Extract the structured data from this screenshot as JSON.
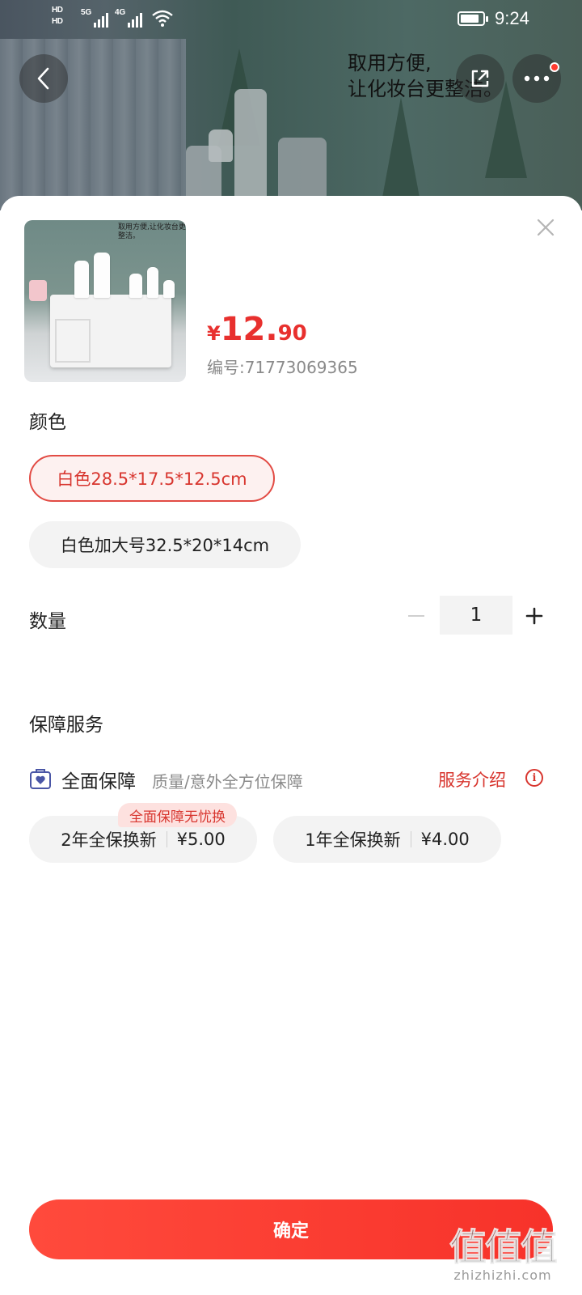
{
  "status_bar": {
    "hd1": "HD",
    "hd2": "HD",
    "net1": "5G",
    "net2": "4G",
    "time": "9:24"
  },
  "background": {
    "caption_line1": "取用方便,",
    "caption_line2": "让化妆台更整洁。"
  },
  "product": {
    "thumb_caption": "取用方便,让化妆台更整洁。",
    "price_currency": "¥",
    "price_integer": "12.",
    "price_decimal": "90",
    "sku_label": "编号:71773069365"
  },
  "color_section": {
    "title": "颜色",
    "options": [
      {
        "label": "白色28.5*17.5*12.5cm",
        "selected": true
      },
      {
        "label": "白色加大号32.5*20*14cm",
        "selected": false
      }
    ]
  },
  "quantity_section": {
    "title": "数量",
    "value": "1"
  },
  "service_section": {
    "title": "保障服务",
    "guarantee_title": "全面保障",
    "guarantee_desc": "质量/意外全方位保障",
    "guarantee_link": "服务介绍",
    "info_glyph": "i",
    "plans": [
      {
        "name": "2年全保换新",
        "price": "¥5.00",
        "badge": "全面保障无忧换"
      },
      {
        "name": "1年全保换新",
        "price": "¥4.00"
      }
    ]
  },
  "confirm_label": "确定",
  "watermark": {
    "big": "值值值",
    "small": "zhizhizhi.com"
  },
  "colors": {
    "accent": "#e8302e",
    "confirm_button": "#f7322a",
    "chip_selected_border": "#e24b44",
    "chip_bg": "#f3f3f3",
    "muted_text": "#8a8a8a"
  },
  "icons": [
    "back-icon",
    "share-icon",
    "more-icon",
    "close-icon",
    "minus-icon",
    "plus-icon",
    "shield-heart-icon",
    "info-icon",
    "wifi-icon",
    "battery-icon",
    "signal-icon"
  ]
}
